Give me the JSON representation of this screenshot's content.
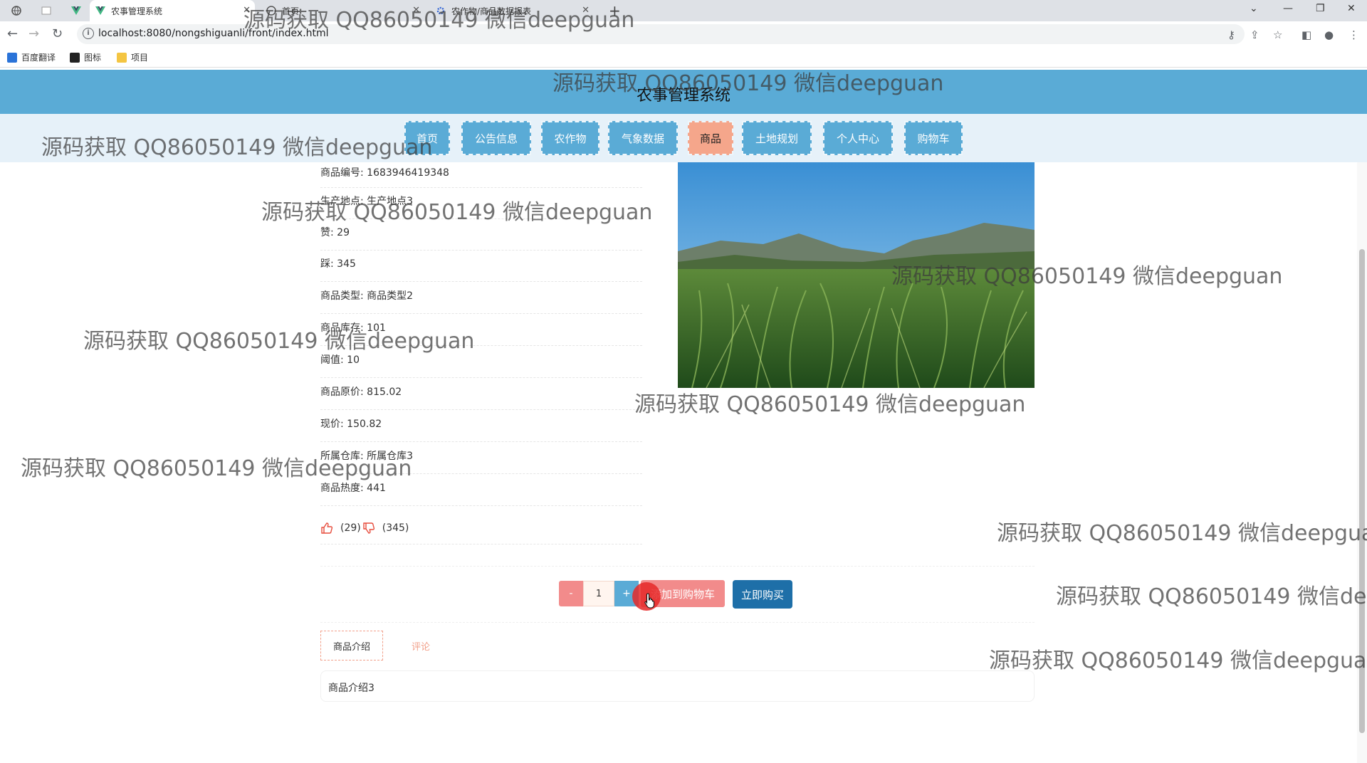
{
  "browser": {
    "tabs": [
      {
        "label": ""
      },
      {
        "label": ""
      },
      {
        "label": "农事管理系统"
      },
      {
        "label": "首页"
      },
      {
        "label": "农作物/商品数据报表"
      }
    ],
    "new_tab": "+",
    "url": "localhost:8080/nongshiguanli/front/index.html",
    "bookmarks": [
      "百度翻译",
      "图标",
      "项目"
    ]
  },
  "site": {
    "title": "农事管理系统",
    "nav": [
      "首页",
      "公告信息",
      "农作物",
      "气象数据",
      "商品",
      "土地规划",
      "个人中心",
      "购物车"
    ],
    "active_nav": "商品"
  },
  "product": {
    "fields": [
      "商品编号: 1683946419348",
      "生产地点: 生产地点3",
      "赞: 29",
      "踩: 345",
      "商品类型: 商品类型2",
      "商品库存: 101",
      "阈值: 10",
      "商品原价: 815.02",
      "现价: 150.82",
      "所属仓库: 所属仓库3",
      "商品热度: 441"
    ],
    "thumbs_up_count": "(29)",
    "thumbs_down_count": "(345)",
    "quantity": "1",
    "minus_label": "-",
    "plus_label": "+",
    "add_to_cart_label": "添加到购物车",
    "buy_now_label": "立即购买",
    "tabs": [
      "商品介绍",
      "评论"
    ],
    "intro_text": "商品介绍3"
  },
  "watermark": "源码获取 QQ86050149 微信deepguan",
  "colors": {
    "header": "#5aabd6",
    "nav_active": "#f5a68b",
    "buy_button": "#1e6fa8",
    "cart_button": "#f28b8b"
  }
}
